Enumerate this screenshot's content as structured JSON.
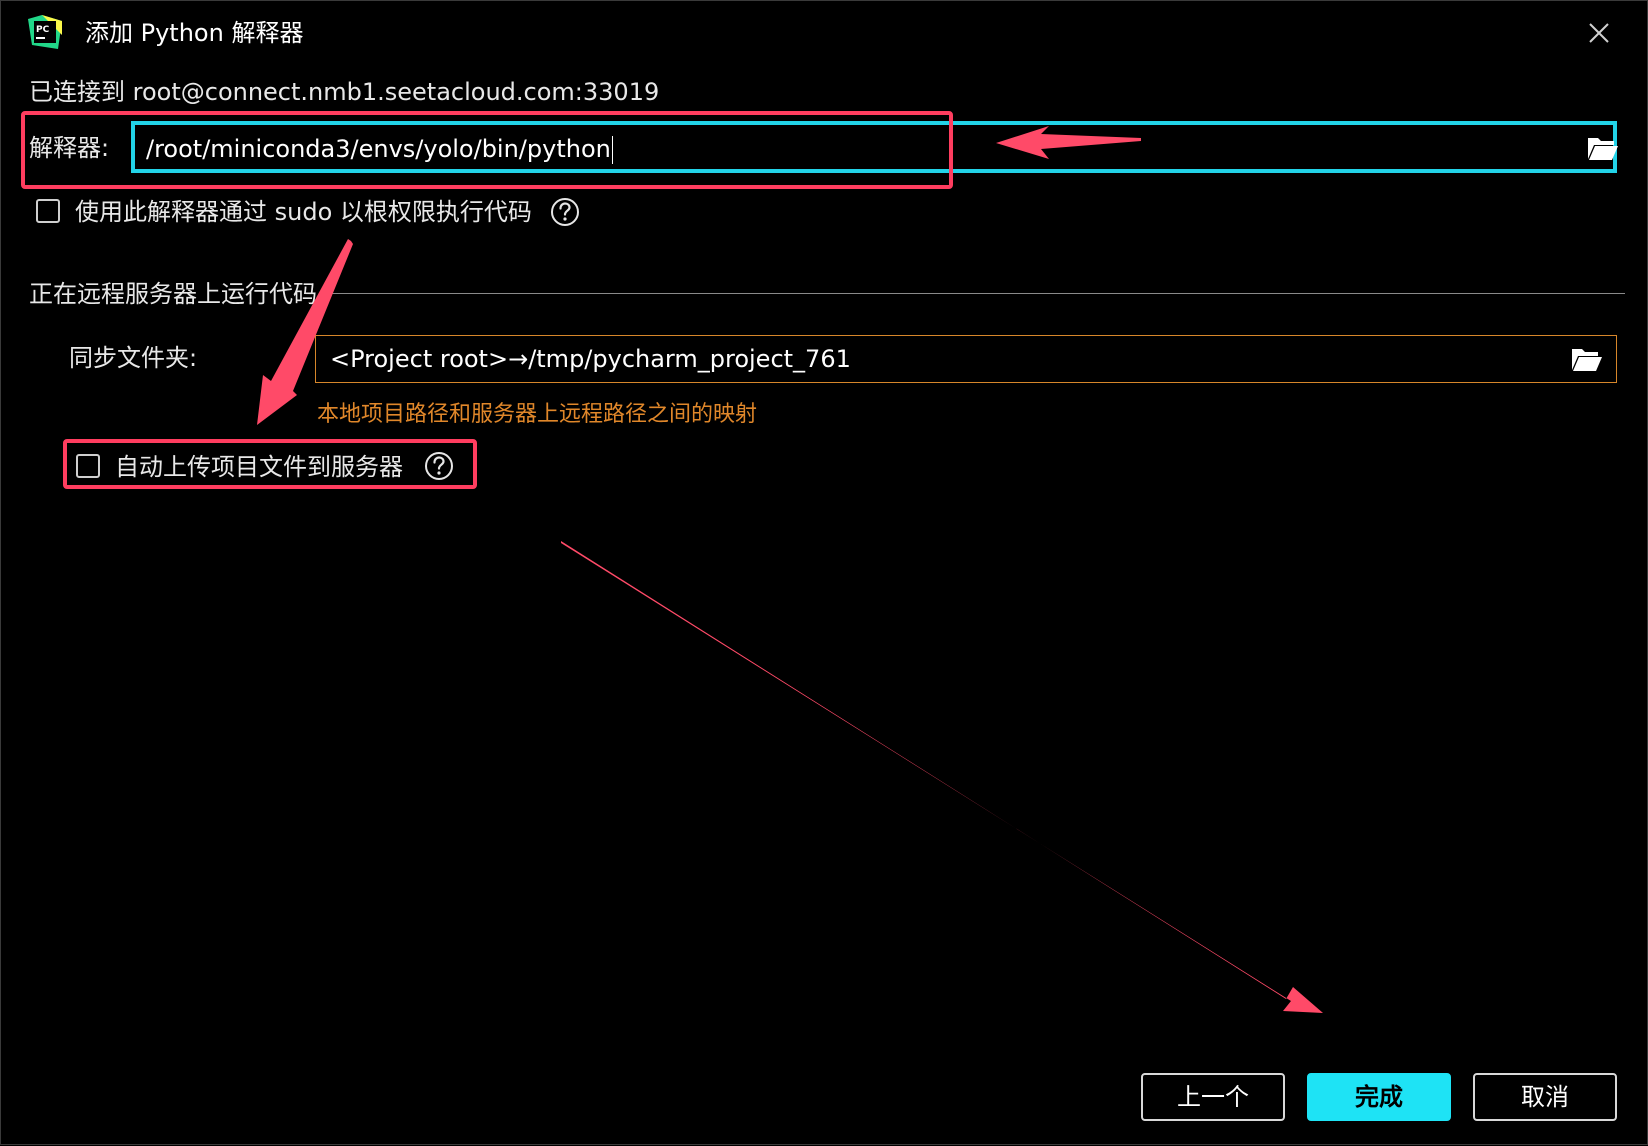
{
  "window": {
    "title": "添加 Python 解释器"
  },
  "connection": {
    "text": "已连接到 root@connect.nmb1.seetacloud.com:33019"
  },
  "interpreter": {
    "label": "解释器:",
    "value": "/root/miniconda3/envs/yolo/bin/python"
  },
  "sudo": {
    "label": "使用此解释器通过 sudo 以根权限执行代码",
    "checked": false
  },
  "remote_section": {
    "title": "正在远程服务器上运行代码"
  },
  "sync": {
    "label": "同步文件夹:",
    "value": "<Project root>→/tmp/pycharm_project_761",
    "hint": "本地项目路径和服务器上远程路径之间的映射"
  },
  "auto_upload": {
    "label": "自动上传项目文件到服务器",
    "checked": false
  },
  "footer": {
    "prev_label": "上一个",
    "finish_label": "完成",
    "cancel_label": "取消"
  },
  "colors": {
    "accent": "#1ee3f5",
    "highlight": "#ff3d5f",
    "hint": "#e0872a"
  }
}
